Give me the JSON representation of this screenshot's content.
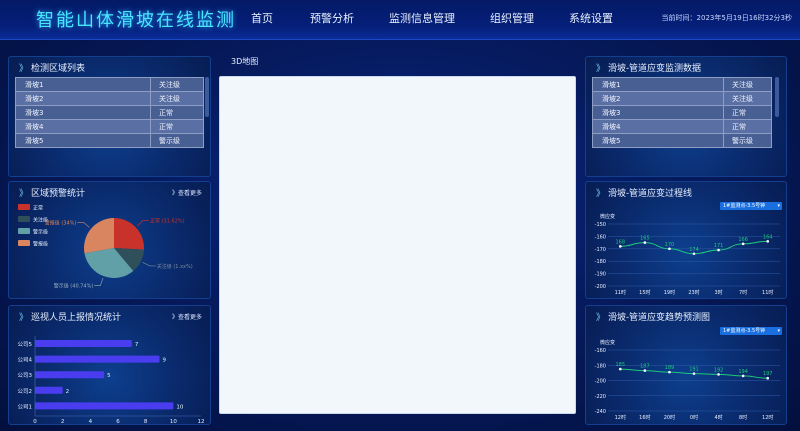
{
  "header": {
    "title": "智能山体滑坡在线监测",
    "nav": [
      "首页",
      "预警分析",
      "监测信息管理",
      "组织管理",
      "系统设置"
    ],
    "clock": "当前时间：2023年5月19日16时32分3秒"
  },
  "area_list": {
    "title": "检测区域列表",
    "rows": [
      {
        "name": "滑坡1",
        "level": "关注级"
      },
      {
        "name": "滑坡2",
        "level": "关注级"
      },
      {
        "name": "滑坡3",
        "level": "正常"
      },
      {
        "name": "滑坡4",
        "level": "正常"
      },
      {
        "name": "滑坡5",
        "level": "警示级"
      }
    ]
  },
  "warning_stats": {
    "title": "区域预警统计",
    "more": "查看更多",
    "legend": [
      {
        "label": "正常",
        "color": "#c9322b"
      },
      {
        "label": "关注级",
        "color": "#2f4f5a"
      },
      {
        "label": "警示级",
        "color": "#62a0a8"
      },
      {
        "label": "警报级",
        "color": "#d98660"
      }
    ]
  },
  "inspection_stats": {
    "title": "巡视人员上报情况统计",
    "more": "查看更多"
  },
  "map": {
    "label": "3D地图"
  },
  "strain_list": {
    "title": "滑坡-管道应变监测数据",
    "rows": [
      {
        "name": "滑坡1",
        "level": "关注级"
      },
      {
        "name": "滑坡2",
        "level": "关注级"
      },
      {
        "name": "滑坡3",
        "level": "正常"
      },
      {
        "name": "滑坡4",
        "level": "正常"
      },
      {
        "name": "滑坡5",
        "level": "警示级"
      }
    ]
  },
  "strain_process": {
    "title": "滑坡-管道应变过程线",
    "select": "1#监测点-3.5号钟"
  },
  "strain_forecast": {
    "title": "滑坡-管道应变趋势预测图",
    "select": "1#监测点-3.5号钟"
  },
  "chart_data": [
    {
      "type": "pie",
      "labels": [
        "正常",
        "关注级",
        "警示级",
        "警报级"
      ],
      "values": [
        31.62,
        16.0,
        40.74,
        34.0
      ],
      "colors": [
        "#c9322b",
        "#2f4f5a",
        "#62a0a8",
        "#d98660"
      ],
      "slice_labels": [
        {
          "text": "正常 (31.62%)",
          "color": "#c9322b"
        },
        {
          "text": "关注级 (1.xx%)",
          "color": "#7a8a9a"
        },
        {
          "text": "警示级 (40.74%)",
          "color": "#9ab0c0"
        },
        {
          "text": "警报级 (34%)",
          "color": "#d98660"
        }
      ]
    },
    {
      "type": "bar",
      "orientation": "horizontal",
      "categories": [
        "公司5",
        "公司4",
        "公司3",
        "公司2",
        "公司1"
      ],
      "values": [
        7,
        9,
        5,
        2,
        10
      ],
      "xlim": [
        0,
        12
      ],
      "xticks": [
        "0",
        "2",
        "4",
        "6",
        "8",
        "10",
        "12"
      ],
      "color": "#4a3df0"
    },
    {
      "type": "line",
      "ylabel": "微应变",
      "categories": [
        "11时",
        "15时",
        "19时",
        "23时",
        "3时",
        "7时",
        "11时"
      ],
      "values": [
        -168,
        -165,
        -170,
        -174,
        -171,
        -166,
        -164
      ],
      "point_labels": [
        "168",
        "165",
        "170",
        "174",
        "171",
        "166",
        "164"
      ],
      "ylim": [
        -200,
        -150
      ],
      "yticks": [
        "-150",
        "-160",
        "-170",
        "-180",
        "-190",
        "-200"
      ],
      "color": "#1ec97a"
    },
    {
      "type": "line",
      "ylabel": "微应变",
      "categories": [
        "12时",
        "16时",
        "20时",
        "0时",
        "4时",
        "8时",
        "12时"
      ],
      "values": [
        -185,
        -187,
        -189,
        -191,
        -192,
        -194,
        -197
      ],
      "point_labels": [
        "185",
        "187",
        "189",
        "191",
        "192",
        "194",
        "197"
      ],
      "ylim": [
        -240,
        -160
      ],
      "yticks": [
        "-160",
        "-180",
        "-200",
        "-220",
        "-240"
      ],
      "color": "#1ec97a"
    }
  ]
}
